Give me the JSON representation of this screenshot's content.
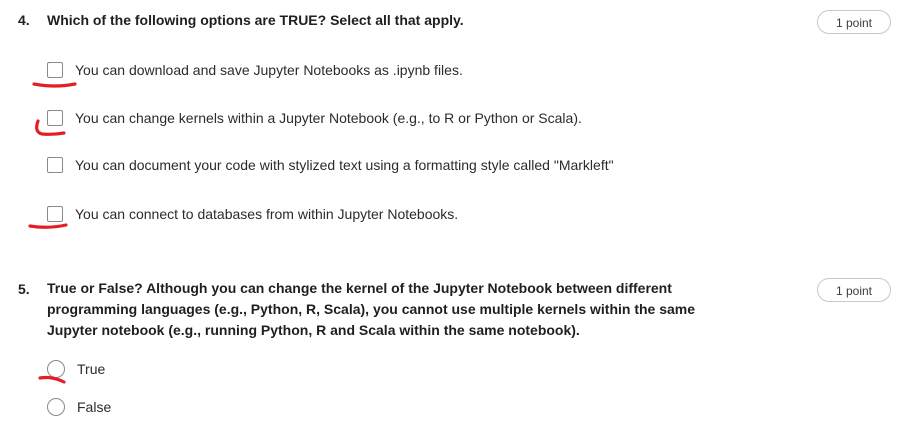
{
  "questions": [
    {
      "number": "4.",
      "text": "Which of the following options are TRUE? Select all that apply.",
      "points": "1 point",
      "type": "checkbox",
      "options": [
        {
          "label": "You can download and save Jupyter Notebooks as .ipynb files."
        },
        {
          "label": "You can change kernels within a Jupyter Notebook (e.g., to R or Python or Scala)."
        },
        {
          "label": "You can document your code with stylized text using a formatting style called \"Markleft\""
        },
        {
          "label": "You can connect to databases from within Jupyter Notebooks."
        }
      ]
    },
    {
      "number": "5.",
      "text_lines": [
        "True or False? Although you can change the kernel of the Jupyter Notebook between different",
        "programming languages (e.g., Python, R, Scala), you cannot use multiple kernels within the same",
        "Jupyter notebook (e.g., running Python, R and Scala within the same notebook)."
      ],
      "points": "1 point",
      "type": "radio",
      "options": [
        {
          "label": "True"
        },
        {
          "label": "False"
        }
      ]
    }
  ],
  "colors": {
    "annotation_stroke": "#e41e26",
    "control_border": "#8a8a8a"
  }
}
